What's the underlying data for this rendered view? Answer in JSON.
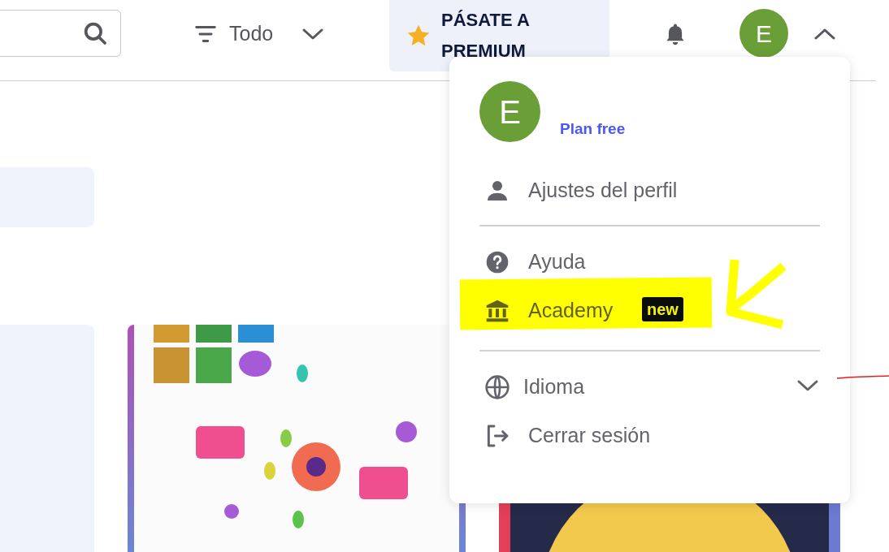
{
  "header": {
    "filter": {
      "label": "Todo"
    },
    "premium": {
      "label": "PÁSATE A PREMIUM"
    },
    "avatar": {
      "initial": "E"
    },
    "menu_open": true
  },
  "account_menu": {
    "avatar": {
      "initial": "E"
    },
    "plan": "Plan free",
    "sections": [
      [
        {
          "kind": "profile",
          "label": "Ajustes del perfil",
          "highlighted": false
        }
      ],
      [
        {
          "kind": "help",
          "label": "Ayuda",
          "highlighted": false
        },
        {
          "kind": "academy",
          "label": "Academy",
          "badge": "new",
          "highlighted": true
        }
      ],
      [
        {
          "kind": "language",
          "label": "Idioma",
          "expanded": false,
          "highlighted": false
        },
        {
          "kind": "logout",
          "label": "Cerrar sesión",
          "highlighted": false
        }
      ]
    ]
  }
}
